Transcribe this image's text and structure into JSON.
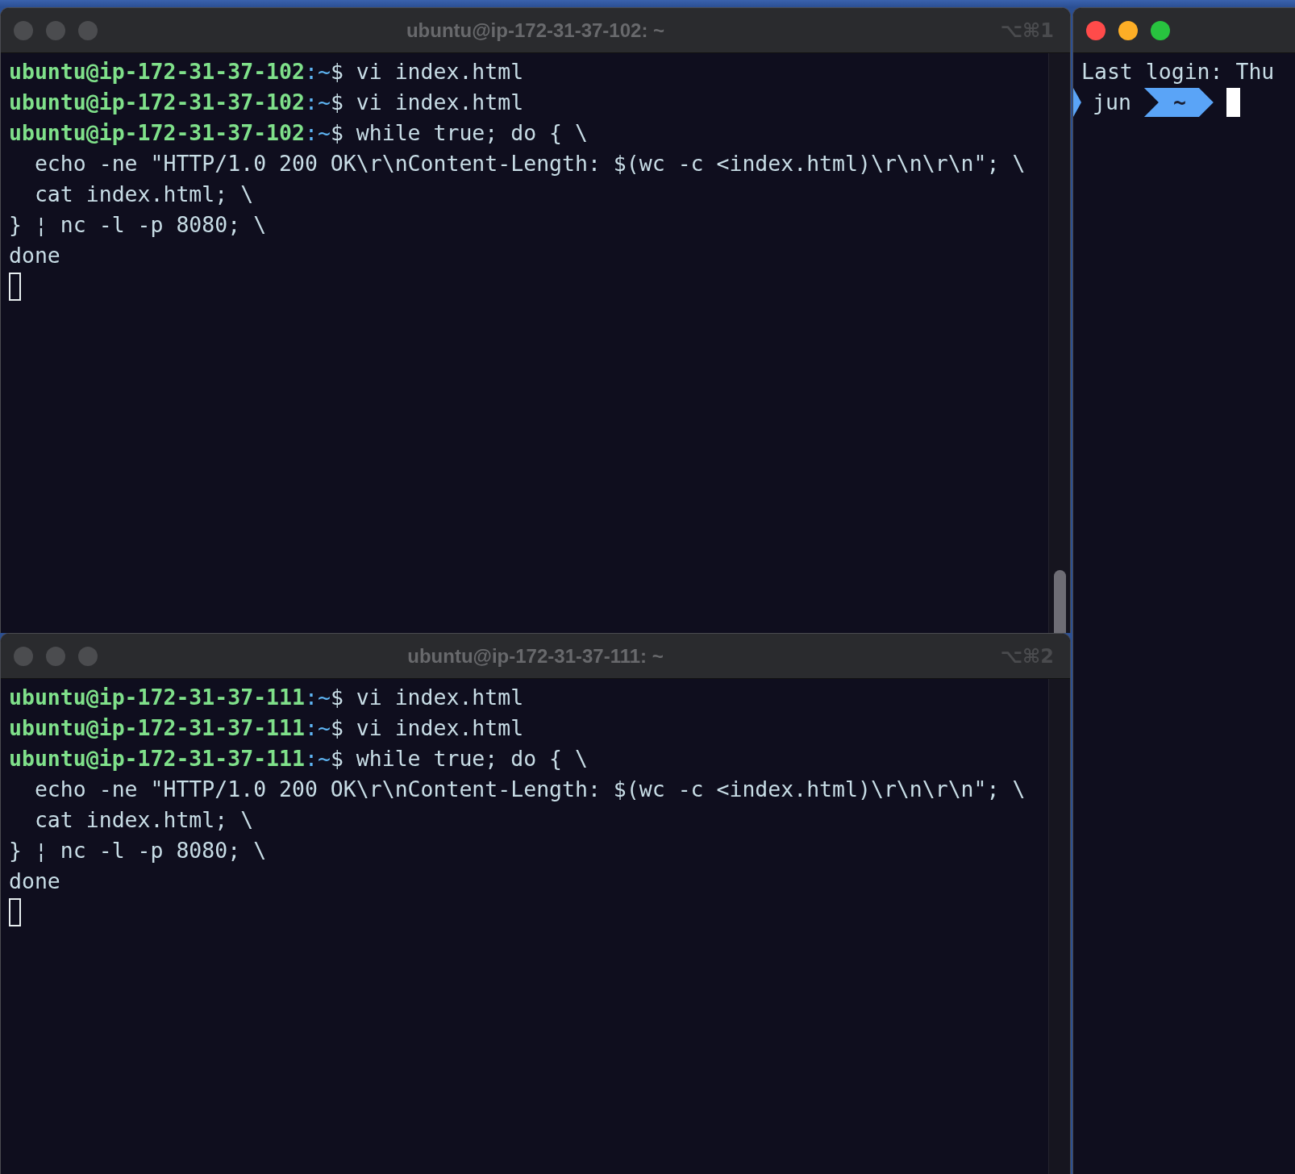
{
  "panes": [
    {
      "title": "ubuntu@ip-172-31-37-102: ~",
      "shortcut": "⌥⌘1",
      "active": false,
      "cursor_focused": false,
      "scrollbar": true,
      "lines": [
        {
          "kind": "prompt",
          "user": "ubuntu@ip-172-31-37-102",
          "path": ":~",
          "command": "$ vi index.html"
        },
        {
          "kind": "prompt",
          "user": "ubuntu@ip-172-31-37-102",
          "path": ":~",
          "command": "$ vi index.html"
        },
        {
          "kind": "prompt",
          "user": "ubuntu@ip-172-31-37-102",
          "path": ":~",
          "command": "$ while true; do { \\"
        },
        {
          "kind": "text",
          "text": "  echo -ne \"HTTP/1.0 200 OK\\r\\nContent-Length: $(wc -c <index.html)\\r\\n\\r\\n\"; \\"
        },
        {
          "kind": "text",
          "text": "  cat index.html; \\"
        },
        {
          "kind": "text",
          "text": "} ¦ nc -l -p 8080; \\"
        },
        {
          "kind": "text",
          "text": "done"
        }
      ]
    },
    {
      "title": "ubuntu@ip-172-31-37-111: ~",
      "shortcut": "⌥⌘2",
      "active": false,
      "cursor_focused": false,
      "scrollbar": false,
      "lines": [
        {
          "kind": "prompt",
          "user": "ubuntu@ip-172-31-37-111",
          "path": ":~",
          "command": "$ vi index.html"
        },
        {
          "kind": "prompt",
          "user": "ubuntu@ip-172-31-37-111",
          "path": ":~",
          "command": "$ vi index.html"
        },
        {
          "kind": "prompt",
          "user": "ubuntu@ip-172-31-37-111",
          "path": ":~",
          "command": "$ while true; do { \\"
        },
        {
          "kind": "text",
          "text": "  echo -ne \"HTTP/1.0 200 OK\\r\\nContent-Length: $(wc -c <index.html)\\r\\n\\r\\n\"; \\"
        },
        {
          "kind": "text",
          "text": "  cat index.html; \\"
        },
        {
          "kind": "text",
          "text": "} ¦ nc -l -p 8080; \\"
        },
        {
          "kind": "text",
          "text": "done"
        }
      ]
    }
  ],
  "side_window": {
    "active": true,
    "cursor_focused": true,
    "lines": [
      {
        "kind": "text",
        "text": "Last login: Thu"
      },
      {
        "kind": "powerline",
        "user": "jun",
        "dir": "~"
      }
    ]
  }
}
